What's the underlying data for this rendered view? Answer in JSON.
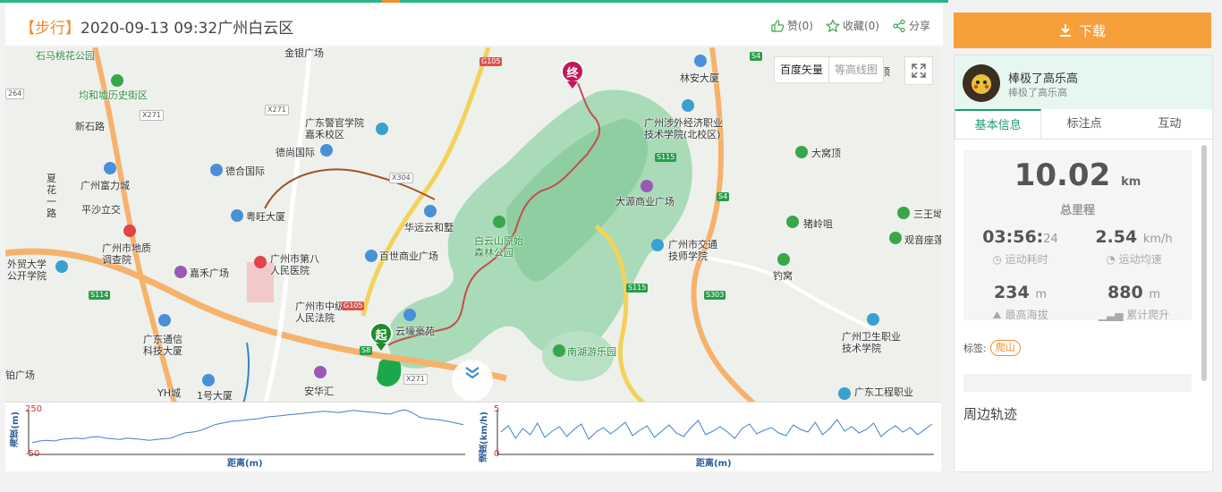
{
  "header": {
    "type_tag": "【步行】",
    "title": "2020-09-13 09:32广州白云区",
    "like": "赞(0)",
    "favorite": "收藏(0)",
    "share": "分享"
  },
  "map": {
    "type_vector": "百度矢量",
    "type_contour": "等高线图",
    "end_label": "终",
    "start_label": "起",
    "labels": {
      "shima": "石马桃花公园",
      "junhe": "均和墟历史街区",
      "xinshi": "新石路",
      "fuli": "广州富力城",
      "xiahua": "夏\n花\n一\n路",
      "pingsha": "平沙立交",
      "dizhi": "广州市地质\n调查院",
      "waimao": "外贸大学\n公开学院",
      "jinyin": "金银广场",
      "jingguan": "广东警官学院\n嘉禾校区",
      "deshang": "德尚国际",
      "dehe": "德合国际",
      "yuewang": "粤旺大厦",
      "renmin8": "广州市第八\n人民医院",
      "jiahe": "嘉禾广场",
      "zhongji": "广州市中级\n人民法院",
      "tongxin": "广东通信\n科技大厦",
      "yhc": "YH城",
      "yihao": "1号大厦",
      "anhui": "安华汇",
      "zhuguang": "铂广场",
      "huayuan": "华远云和墅",
      "baishi": "百世商业广场",
      "yunjing": "云壕豪苑",
      "baiyun": "白云山原始\n森林公园",
      "nanhu": "南湖游乐园",
      "linan": "林安大厦",
      "shewai": "广州涉外经济职业\n技术学院(北校区)",
      "dayuan": "大源商业广场",
      "jiaotong": "广州市交通\n技师学院",
      "dawoding": "大窝顶",
      "zhulingju": "猪岭咀",
      "diaowo": "钓窝",
      "sanwang": "三王坳",
      "guanyin": "观音座莲",
      "weisheng": "广州卫生职业\n技术学院",
      "gongcheng": "广东工程职业",
      "ding": "顶"
    },
    "road_tags": [
      "G105",
      "S4",
      "X271",
      "X304",
      "S115",
      "S114",
      "S303",
      "S8",
      "X271",
      "G105",
      "S4",
      "S115",
      "264",
      "X271"
    ]
  },
  "charts": {
    "elevation": {
      "ylabel": "海拔(m)",
      "ymax": "250",
      "ymin": "-50",
      "xlabel": "距离(m)"
    },
    "speed": {
      "ylabel": "速度(km/h)",
      "ymax": "5",
      "ymin": "0",
      "xlabel": "距离(m)"
    }
  },
  "chart_data": [
    {
      "type": "line",
      "ylabel": "海拔(m)",
      "xlabel": "距离(m)",
      "ylim": [
        -50,
        250
      ],
      "series": [
        {
          "values": [
            30,
            40,
            45,
            40,
            50,
            55,
            60,
            55,
            65,
            70,
            60,
            55,
            50,
            60,
            55,
            50,
            45,
            50,
            55,
            60,
            80,
            95,
            100,
            110,
            130,
            150,
            160,
            170,
            175,
            180,
            185,
            190,
            200,
            205,
            210,
            215,
            220,
            225,
            230,
            235,
            240,
            235,
            230,
            240,
            245,
            240,
            235,
            230,
            225,
            220,
            240,
            250,
            230,
            200,
            190,
            185,
            180,
            170,
            160,
            150
          ]
        }
      ]
    },
    {
      "type": "line",
      "ylabel": "速度(km/h)",
      "xlabel": "距离(m)",
      "ylim": [
        0,
        5
      ],
      "series": [
        {
          "values": [
            2.5,
            3.2,
            1.8,
            2.9,
            2.2,
            3.5,
            1.9,
            2.6,
            3.1,
            2.0,
            2.8,
            3.4,
            1.7,
            2.5,
            3.0,
            2.3,
            2.9,
            3.6,
            2.1,
            2.7,
            3.2,
            1.9,
            2.6,
            3.3,
            2.4,
            2.0,
            3.0,
            3.8,
            2.2,
            2.6,
            3.1,
            2.5,
            1.8,
            2.9,
            3.4,
            2.3,
            2.7,
            3.0,
            2.4,
            2.1,
            3.3,
            2.8,
            2.5,
            3.6,
            2.2,
            2.9,
            3.9,
            2.6,
            3.1,
            2.4,
            2.8,
            3.5,
            2.0,
            2.7,
            3.2,
            2.5,
            3.0,
            2.2,
            2.8,
            3.4
          ]
        }
      ]
    }
  ],
  "sidebar": {
    "download": "下载",
    "user_name": "棒极了高乐高",
    "user_sub": "棒极了高乐高",
    "tabs": [
      "基本信息",
      "标注点",
      "互动"
    ],
    "distance_value": "10.02",
    "distance_unit": "km",
    "distance_label": "总里程",
    "duration_main": "03:56:",
    "duration_sec": "24",
    "duration_label": "运动耗时",
    "speed_value": "2.54",
    "speed_unit": "km/h",
    "speed_label": "运动均速",
    "max_alt_value": "234",
    "max_alt_unit": "m",
    "max_alt_label": "最高海拔",
    "climb_value": "880",
    "climb_unit": "m",
    "climb_label": "累计爬升",
    "tag_label": "标签:",
    "tag_chip": "爬山",
    "nearby": "周边轨迹"
  },
  "colors": {
    "accent_green": "#1e9e6b",
    "download_orange": "#f5a03b",
    "track_red": "#c0504d"
  }
}
